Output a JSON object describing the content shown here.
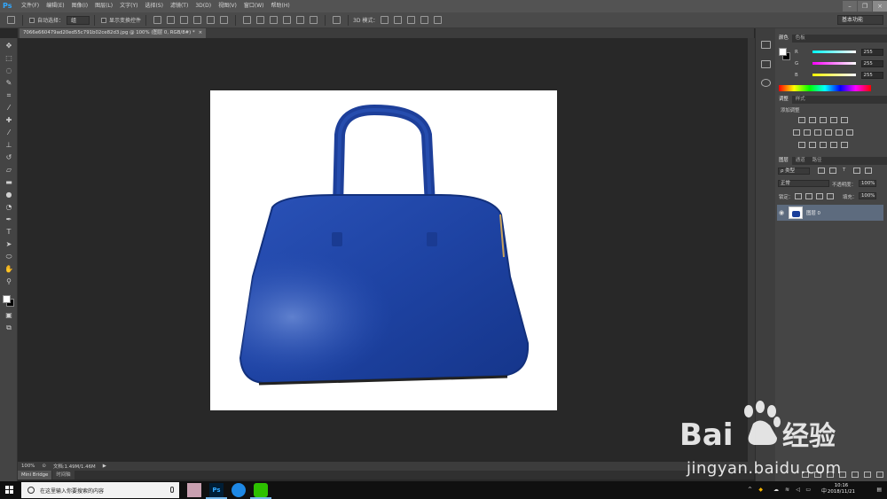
{
  "app": {
    "logo": "Ps"
  },
  "menu": [
    "文件(F)",
    "编辑(E)",
    "图像(I)",
    "图层(L)",
    "文字(Y)",
    "选择(S)",
    "滤镜(T)",
    "3D(D)",
    "视图(V)",
    "窗口(W)",
    "帮助(H)"
  ],
  "options": {
    "auto_select_label": "自动选择：",
    "auto_select_value": "组",
    "show_transform_label": "显示变换控件",
    "mode_3d_label": "3D 模式：",
    "workspace": "基本功能"
  },
  "document": {
    "tab_title": "7066e660479ad20ed55c791b02ce82d3.jpg @ 100% (图层 0, RGB/8#) *",
    "close": "×"
  },
  "status": {
    "zoom": "100%",
    "doc_info": "文档:1.49M/1.46M"
  },
  "bottom_tabs": [
    "Mini Bridge",
    "时间轴"
  ],
  "color_panel": {
    "tabs": [
      "颜色",
      "色板"
    ],
    "channels": [
      {
        "label": "R",
        "value": "255",
        "color": "#e33"
      },
      {
        "label": "G",
        "value": "255",
        "color": "#3c3"
      },
      {
        "label": "B",
        "value": "255",
        "color": "#33e"
      }
    ]
  },
  "adjust_panel": {
    "tabs": [
      "调整",
      "样式"
    ],
    "title": "添加调整"
  },
  "layers_panel": {
    "tabs": [
      "图层",
      "通道",
      "路径"
    ],
    "kind": "ρ 类型",
    "blend_mode": "正常",
    "opacity_label": "不透明度：",
    "opacity_value": "100%",
    "lock_label": "锁定：",
    "fill_label": "填充：",
    "fill_value": "100%",
    "layer_name": "图层 0"
  },
  "taskbar": {
    "search_placeholder": "在这里输入你要搜索的内容",
    "ime": "中",
    "time": "10:16",
    "date": "2018/11/21"
  },
  "watermark": {
    "brand": "Bai",
    "brand_cn": "经验",
    "url": "jingyan.baidu.com"
  },
  "colors": {
    "ps_blue": "#31a8ff",
    "bag_blue": "#1e43a3",
    "layer_selected": "#5d6b7e"
  }
}
